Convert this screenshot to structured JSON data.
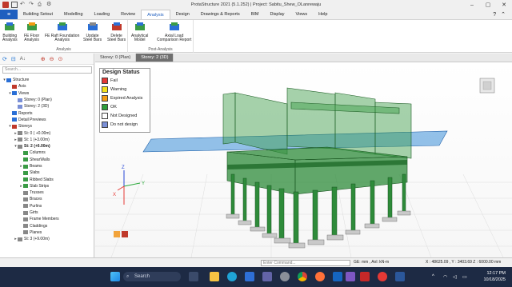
{
  "window": {
    "title": "ProtaStructure 2021 (5.1.252) | Project: Sabitu_Shew_OLanrewaju"
  },
  "ribbon_tabs": [
    "Building Setout",
    "Modelling",
    "Loading",
    "Review",
    "Analysis",
    "Design",
    "Drawings & Reports",
    "BIM",
    "Display",
    "Views",
    "Help"
  ],
  "active_tab": "Analysis",
  "ribbon": {
    "analysis_group": {
      "label": "Analysis",
      "buttons": [
        {
          "label": "Building\nAnalysis",
          "icon": "building-analysis-icon"
        },
        {
          "label": "FE Floor\nAnalysis",
          "icon": "fe-floor-icon"
        },
        {
          "label": "FE Raft Foundation\nAnalysis",
          "icon": "fe-raft-icon"
        },
        {
          "label": "Update\nSteel Bars",
          "icon": "update-bars-icon"
        },
        {
          "label": "Delete\nSteel Bars",
          "icon": "delete-bars-icon"
        }
      ]
    },
    "post_group": {
      "label": "Post-Analysis",
      "buttons": [
        {
          "label": "Analytical\nModel",
          "icon": "analytical-model-icon"
        },
        {
          "label": "Axial Load\nComparison Report",
          "icon": "axial-load-icon"
        }
      ]
    }
  },
  "left_panel": {
    "search_placeholder": "Search...",
    "tree": [
      {
        "label": "Structure",
        "level": 0,
        "exp": "▾",
        "bold": false
      },
      {
        "label": "Axis",
        "level": 1,
        "exp": "",
        "bold": false
      },
      {
        "label": "Views",
        "level": 1,
        "exp": "▾",
        "bold": false
      },
      {
        "label": "Storey: 0 (Plan)",
        "level": 2,
        "exp": "",
        "bold": false
      },
      {
        "label": "Storey: 2 (3D)",
        "level": 2,
        "exp": "",
        "bold": false
      },
      {
        "label": "Reports",
        "level": 1,
        "exp": "",
        "bold": false
      },
      {
        "label": "Detail Previews",
        "level": 1,
        "exp": "",
        "bold": false
      },
      {
        "label": "Storeys",
        "level": 1,
        "exp": "▾",
        "bold": false
      },
      {
        "label": "St: 0 ( +0.00m)",
        "level": 2,
        "exp": "▸",
        "bold": false
      },
      {
        "label": "St: 1 (+3.00m)",
        "level": 2,
        "exp": "▸",
        "bold": false
      },
      {
        "label": "St: 2 (+6.00m)",
        "level": 2,
        "exp": "▾",
        "bold": true
      },
      {
        "label": "Columns",
        "level": 3,
        "exp": "",
        "bold": false
      },
      {
        "label": "ShearWalls",
        "level": 3,
        "exp": "",
        "bold": false
      },
      {
        "label": "Beams",
        "level": 3,
        "exp": "▸",
        "bold": false
      },
      {
        "label": "Slabs",
        "level": 3,
        "exp": "",
        "bold": false
      },
      {
        "label": "Ribbed Slabs",
        "level": 3,
        "exp": "",
        "bold": false
      },
      {
        "label": "Slab Strips",
        "level": 3,
        "exp": "▸",
        "bold": false
      },
      {
        "label": "Trusses",
        "level": 3,
        "exp": "",
        "bold": false
      },
      {
        "label": "Braces",
        "level": 3,
        "exp": "",
        "bold": false
      },
      {
        "label": "Purlins",
        "level": 3,
        "exp": "",
        "bold": false
      },
      {
        "label": "Girts",
        "level": 3,
        "exp": "",
        "bold": false
      },
      {
        "label": "Frame Members",
        "level": 3,
        "exp": "",
        "bold": false
      },
      {
        "label": "Claddings",
        "level": 3,
        "exp": "",
        "bold": false
      },
      {
        "label": "Planes",
        "level": 3,
        "exp": "",
        "bold": false
      },
      {
        "label": "St: 3 (+9.00m)",
        "level": 2,
        "exp": "▸",
        "bold": false
      }
    ]
  },
  "doc_tabs": [
    {
      "label": "Storey: 0 (Plan)",
      "active": false
    },
    {
      "label": "Storey: 2 (3D)",
      "active": true
    }
  ],
  "legend": {
    "title": "Design Status",
    "items": [
      {
        "label": "Fail",
        "color": "#e53935"
      },
      {
        "label": "Warning",
        "color": "#f4e11b"
      },
      {
        "label": "Expired Analysis",
        "color": "#f39c12"
      },
      {
        "label": "OK",
        "color": "#2e9e3a"
      },
      {
        "label": "Not Designed",
        "color": "#ffffff"
      },
      {
        "label": "Do not design",
        "color": "#7a8fd6"
      }
    ]
  },
  "axes": {
    "x": "X",
    "y": "Y",
    "z": "Z"
  },
  "statusbar": {
    "command_placeholder": "Enter Command...",
    "units": "GE: mm , Anl: kN-m",
    "coords": "X : 48625.09 , Y : 3403.69    Z : 6000.00 mm"
  },
  "taskbar": {
    "search_label": "Search",
    "time": "12:17 PM",
    "date": "10/18/2025"
  },
  "colors": {
    "accent": "#1f5fbf",
    "structure": "#2e8b3a",
    "slab": "#3d8fd8",
    "taskbar": "#1d2a44"
  }
}
